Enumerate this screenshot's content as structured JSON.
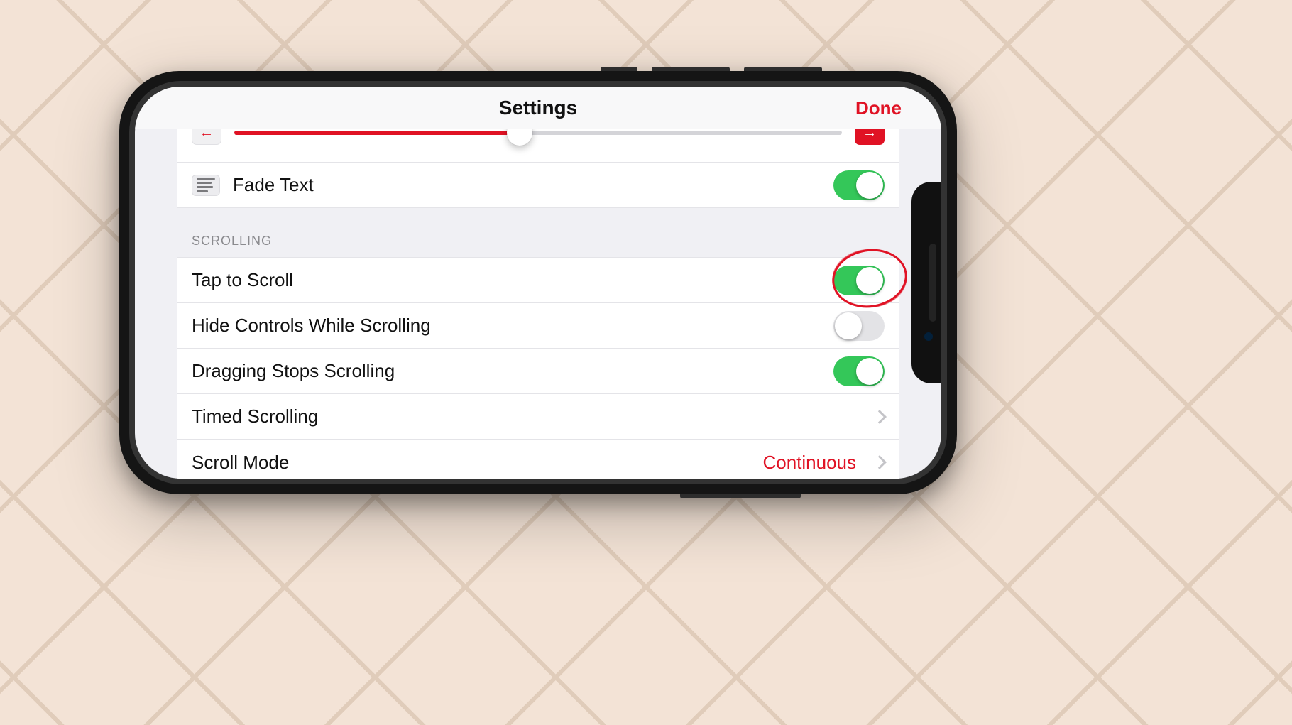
{
  "colors": {
    "accent": "#e01224",
    "toggle_on": "#34c759"
  },
  "nav": {
    "title": "Settings",
    "done": "Done"
  },
  "slider": {
    "value_percent": 47
  },
  "fade_text": {
    "label": "Fade Text",
    "on": true
  },
  "scrolling": {
    "header": "SCROLLING",
    "tap_to_scroll": {
      "label": "Tap to Scroll",
      "on": true,
      "highlighted": true
    },
    "hide_controls": {
      "label": "Hide Controls While Scrolling",
      "on": false
    },
    "dragging_stops": {
      "label": "Dragging Stops Scrolling",
      "on": true
    },
    "timed_scrolling": {
      "label": "Timed Scrolling"
    },
    "scroll_mode": {
      "label": "Scroll Mode",
      "value": "Continuous"
    }
  }
}
